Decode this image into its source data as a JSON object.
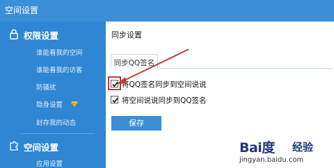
{
  "window": {
    "title": "空间设置"
  },
  "sidebar": {
    "groups": [
      {
        "header": "权限设置",
        "icon": "lock-icon",
        "items": [
          {
            "label": "谁能看我的空间"
          },
          {
            "label": "谁能看我的访客"
          },
          {
            "label": "防骚扰"
          },
          {
            "label": "隐身设置",
            "badge_icon": "yellow-diamond-icon"
          },
          {
            "label": "封存我的动态"
          }
        ]
      },
      {
        "header": "空间设置",
        "icon": "puzzle-icon",
        "items": [
          {
            "label": "应用设置"
          }
        ]
      }
    ]
  },
  "main": {
    "heading": "同步设置",
    "tabs": [
      {
        "label": "同步QQ签名",
        "active": true
      }
    ],
    "options": [
      {
        "label": "将QQ签名同步到空间说说",
        "checked": true,
        "highlighted": true
      },
      {
        "label": "将空间说说同步到QQ签名",
        "checked": true
      }
    ],
    "save_label": "保存"
  },
  "watermark": {
    "logo": "Bai度",
    "brand": "经验",
    "url": "jingyan.baidu.com"
  },
  "colors": {
    "sidebar_bg": "#2f86d2",
    "titlebar_bg": "#3a8fd6",
    "button_bg": "#3a8fd6",
    "annotation_red": "#c23a3a"
  }
}
